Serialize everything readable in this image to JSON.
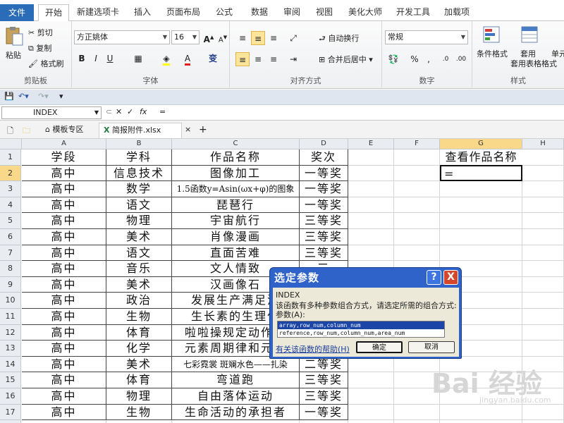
{
  "tabs": [
    "文件",
    "开始",
    "新建选项卡",
    "插入",
    "页面布局",
    "公式",
    "数据",
    "审阅",
    "视图",
    "美化大师",
    "开发工具",
    "加载项"
  ],
  "clipboard": {
    "paste": "粘贴",
    "cut": "剪切",
    "copy": "复制",
    "format_painter": "格式刷",
    "label": "剪贴板"
  },
  "font": {
    "name": "方正姚体",
    "size": "16",
    "bold": "B",
    "italic": "I",
    "underline": "U",
    "label": "字体",
    "wen": "变"
  },
  "alignment": {
    "wrap": "自动换行",
    "merge": "合并后居中",
    "label": "对齐方式"
  },
  "number": {
    "format": "常规",
    "percent": "%",
    "comma": ",",
    "label": "数字"
  },
  "styles": {
    "conditional": "条件格式",
    "table_style": "套用表格格式",
    "cell_style": "单元",
    "label": "样式"
  },
  "formula_bar": {
    "name": "INDEX",
    "fx": "fx",
    "content": "="
  },
  "doc_tabs": {
    "template": "模板专区",
    "file": "简报附件.xlsx",
    "close": "×",
    "add": "+"
  },
  "columns": [
    "A",
    "B",
    "C",
    "D",
    "E",
    "F",
    "G",
    "H"
  ],
  "rows": [
    [
      "学段",
      "学科",
      "作品名称",
      "奖次"
    ],
    [
      "高中",
      "信息技术",
      "图像加工",
      "一等奖"
    ],
    [
      "高中",
      "数学",
      "1.5函数y=Asin(ωx+φ)的图象",
      "一等奖"
    ],
    [
      "高中",
      "语文",
      "琵琶行",
      "一等奖"
    ],
    [
      "高中",
      "物理",
      "宇宙航行",
      "三等奖"
    ],
    [
      "高中",
      "美术",
      "肖像漫画",
      "三等奖"
    ],
    [
      "高中",
      "语文",
      "直面苦难",
      "三等奖"
    ],
    [
      "高中",
      "音乐",
      "文人情致",
      "三"
    ],
    [
      "高中",
      "美术",
      "汉画像石",
      "三"
    ],
    [
      "高中",
      "政治",
      "发展生产满足消",
      ""
    ],
    [
      "高中",
      "生物",
      "生长素的生理作",
      ""
    ],
    [
      "高中",
      "体育",
      "啦啦操规定动作队",
      ""
    ],
    [
      "高中",
      "化学",
      "元素周期律和元素",
      ""
    ],
    [
      "高中",
      "美术",
      "七彩霓裳 斑斓水色——扎染",
      "二等奖"
    ],
    [
      "高中",
      "体育",
      "弯道跑",
      "三等奖"
    ],
    [
      "高中",
      "物理",
      "自由落体运动",
      "三等奖"
    ],
    [
      "高中",
      "生物",
      "生命活动的承担者",
      "一等奖"
    ]
  ],
  "g_cells": {
    "g1": "查看作品名称",
    "g2": "="
  },
  "dialog": {
    "title": "选定参数",
    "help_btn": "?",
    "close_btn": "X",
    "func": "INDEX",
    "desc": "该函数有多种参数组合方式，请选定所需的组合方式:",
    "args_label": "参数(A):",
    "options": [
      "array,row_num,column_num",
      "reference,row_num,column_num,area_num"
    ],
    "help_link": "有关该函数的帮助(H)",
    "ok": "确定",
    "cancel": "取消"
  },
  "watermark": {
    "brand": "Bai 经验",
    "url": "jingyan.baidu.com"
  }
}
